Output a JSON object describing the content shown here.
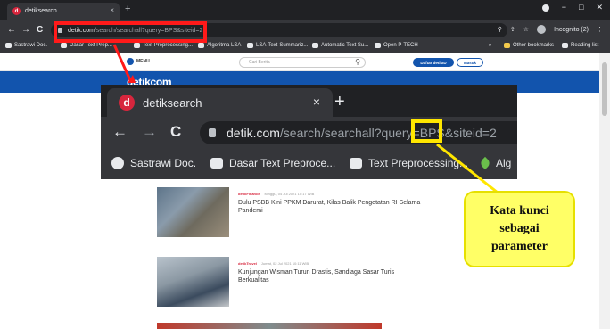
{
  "browser": {
    "tab_title": "detiksearch",
    "tab_close": "×",
    "new_tab": "+",
    "favicon_letter": "d",
    "url_domain": "detik.com",
    "url_path": "/search/searchall?query=BPS&siteid=2",
    "incognito_label": "Incognito (2)",
    "window_min": "−",
    "window_max": "□",
    "window_close": "✕",
    "nav_back": "←",
    "nav_forward": "→",
    "nav_reload": "C",
    "bookmarks": [
      {
        "label": "Sastrawi Doc."
      },
      {
        "label": "Dasar Text Prep..."
      },
      {
        "label": "Text Preprocessing..."
      },
      {
        "label": "Algoritma LSA"
      },
      {
        "label": "LSA-Text-Summariz..."
      },
      {
        "label": "Automatic Text Su..."
      },
      {
        "label": "Open P-TECH"
      }
    ],
    "bookmarks_more": "»",
    "other_bookmarks": "Other bookmarks",
    "reading_list": "Reading list"
  },
  "site": {
    "menu_label": "MENU",
    "search_placeholder": "Cari Berita",
    "search_icon": "⚲",
    "register_label": "Daftar detikID",
    "login_label": "Masuk",
    "logo_text": "detikcom"
  },
  "articles": [
    {
      "category": "detikFinance",
      "date": "Minggu, 04 Jul 2021 10:17 WIB",
      "title": "Dulu PSBB Kini PPKM Darurat, Kilas Balik Pengetatan RI Selama Pandemi"
    },
    {
      "category": "detikTravel",
      "date": "Jumat, 02 Jul 2021 10:11 WIB",
      "title": "Kunjungan Wisman Turun Drastis, Sandiaga Sasar Turis Berkualitas"
    }
  ],
  "zoom": {
    "tab_title": "detiksearch",
    "favicon_letter": "d",
    "tab_close": "×",
    "new_tab": "+",
    "nav_back": "←",
    "nav_forward": "→",
    "nav_reload": "C",
    "url_domain": "detik.com",
    "url_path": "/search/searchall?query=BPS&siteid=2",
    "bookmarks": [
      {
        "label": "Sastrawi Doc."
      },
      {
        "label": "Dasar Text Preproce..."
      },
      {
        "label": "Text Preprocessing..."
      },
      {
        "label": "Alg"
      }
    ]
  },
  "annotation": {
    "callout_text": "Kata kunci sebagai parameter",
    "red_color": "#ff1a1a",
    "yellow_color": "#ffe600"
  },
  "icons": {
    "lock": "lock-icon",
    "github": "github-icon",
    "medium": "medium-icon",
    "star": "star-icon",
    "search": "search-icon"
  }
}
